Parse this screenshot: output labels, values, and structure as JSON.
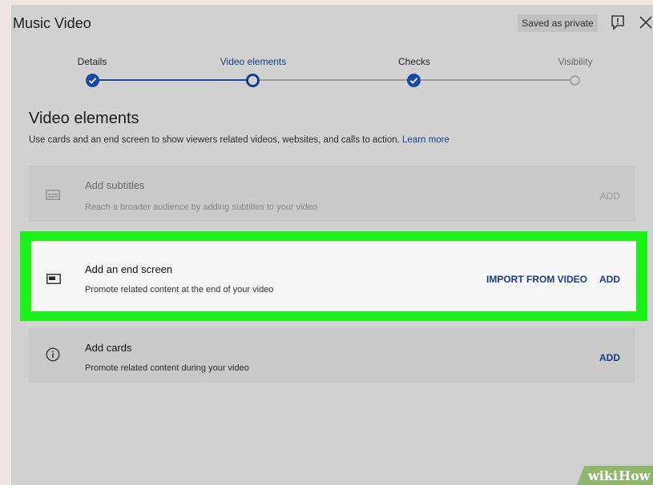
{
  "dialog": {
    "title": "Music Video",
    "saved_status": "Saved as private"
  },
  "stepper": [
    {
      "label": "Details",
      "state": "done"
    },
    {
      "label": "Video elements",
      "state": "current"
    },
    {
      "label": "Checks",
      "state": "done"
    },
    {
      "label": "Visibility",
      "state": "todo"
    }
  ],
  "section": {
    "heading": "Video elements",
    "description": "Use cards and an end screen to show viewers related videos, websites, and calls to action.",
    "learn_more": "Learn more"
  },
  "elements": {
    "subtitles": {
      "title": "Add subtitles",
      "subtitle": "Reach a broader audience by adding subtitles to your video",
      "add_label": "ADD",
      "icon": "subtitles-icon"
    },
    "end_screen": {
      "title": "Add an end screen",
      "subtitle": "Promote related content at the end of your video",
      "import_label": "IMPORT FROM VIDEO",
      "add_label": "ADD",
      "icon": "end-screen-icon"
    },
    "cards": {
      "title": "Add cards",
      "subtitle": "Promote related content during your video",
      "add_label": "ADD",
      "icon": "info-icon"
    }
  },
  "watermark": {
    "wiki": "wiki",
    "how": "How"
  },
  "colors": {
    "accent_blue": "#1e3e84",
    "highlight_green": "#1bf21a",
    "dim_overlay": "#d1d1d1"
  }
}
